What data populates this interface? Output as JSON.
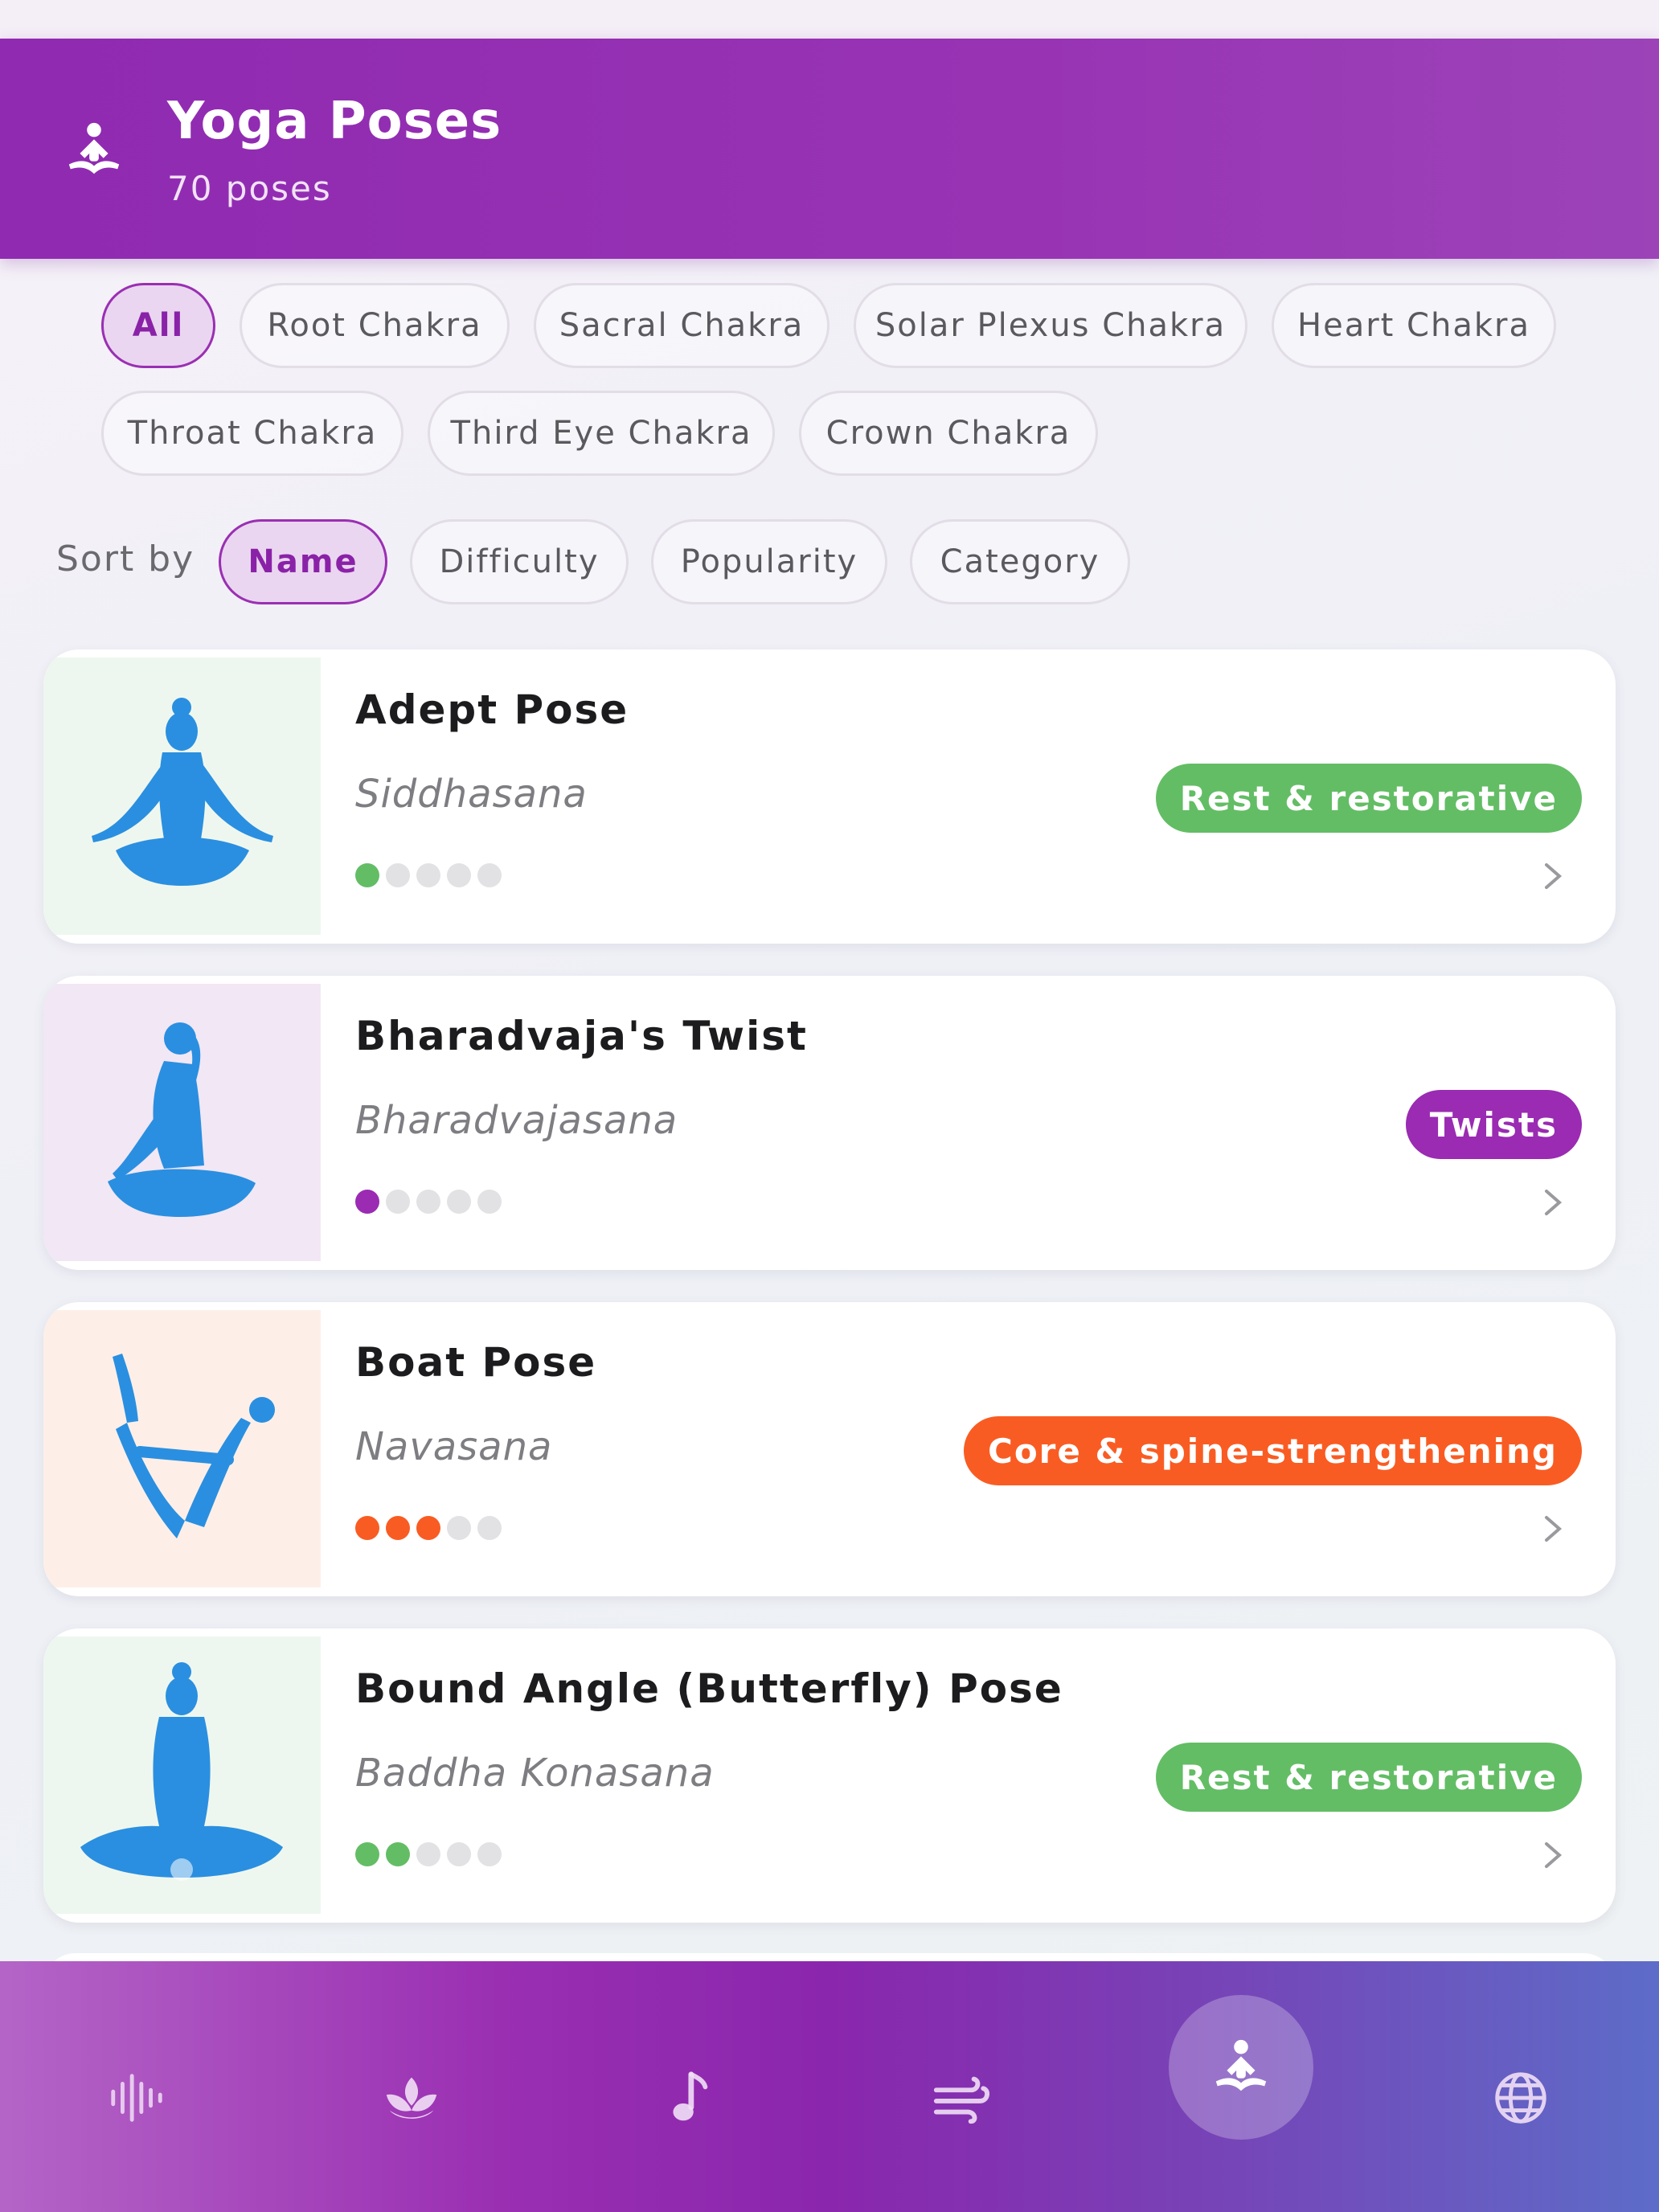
{
  "header": {
    "icon": "meditation-icon",
    "title": "Yoga Poses",
    "subtitle": "70 poses"
  },
  "filters": {
    "chips": [
      {
        "label": "All",
        "active": true
      },
      {
        "label": "Root Chakra",
        "active": false
      },
      {
        "label": "Sacral Chakra",
        "active": false
      },
      {
        "label": "Solar Plexus Chakra",
        "active": false
      },
      {
        "label": "Heart Chakra",
        "active": false
      },
      {
        "label": "Throat Chakra",
        "active": false
      },
      {
        "label": "Third Eye Chakra",
        "active": false
      },
      {
        "label": "Crown Chakra",
        "active": false
      }
    ]
  },
  "sort": {
    "label": "Sort by",
    "options": [
      {
        "label": "Name",
        "active": true
      },
      {
        "label": "Difficulty",
        "active": false
      },
      {
        "label": "Popularity",
        "active": false
      },
      {
        "label": "Category",
        "active": false
      }
    ]
  },
  "poses": [
    {
      "name": "Adept Pose",
      "sanskrit": "Siddhasana",
      "category": "Rest & restorative",
      "category_color": "#63bd65",
      "thumb_bg": "#eef7ef",
      "difficulty": 1,
      "difficulty_max": 5,
      "icon": "seated-lotus-pose-icon"
    },
    {
      "name": "Bharadvaja's Twist",
      "sanskrit": "Bharadvajasana",
      "category": "Twists",
      "category_color": "#9a2bb2",
      "thumb_bg": "#f2e7f5",
      "difficulty": 1,
      "difficulty_max": 5,
      "icon": "seated-twist-pose-icon"
    },
    {
      "name": "Boat Pose",
      "sanskrit": "Navasana",
      "category": "Core & spine-strengthening",
      "category_color": "#f95c23",
      "thumb_bg": "#fdefe8",
      "difficulty": 3,
      "difficulty_max": 5,
      "icon": "boat-pose-icon"
    },
    {
      "name": "Bound Angle (Butterfly) Pose",
      "sanskrit": "Baddha Konasana",
      "category": "Rest & restorative",
      "category_color": "#63bd65",
      "thumb_bg": "#eef7ef",
      "difficulty": 2,
      "difficulty_max": 5,
      "icon": "butterfly-pose-icon"
    }
  ],
  "tabbar": {
    "tabs": [
      {
        "icon": "waveform-icon",
        "active": false
      },
      {
        "icon": "lotus-icon",
        "active": false
      },
      {
        "icon": "music-note-icon",
        "active": false
      },
      {
        "icon": "wind-icon",
        "active": false
      },
      {
        "icon": "meditation-icon",
        "active": true
      },
      {
        "icon": "globe-icon",
        "active": false
      }
    ]
  },
  "colors": {
    "accent": "#9a2fb3",
    "dot_inactive": "#e2e2e4"
  }
}
